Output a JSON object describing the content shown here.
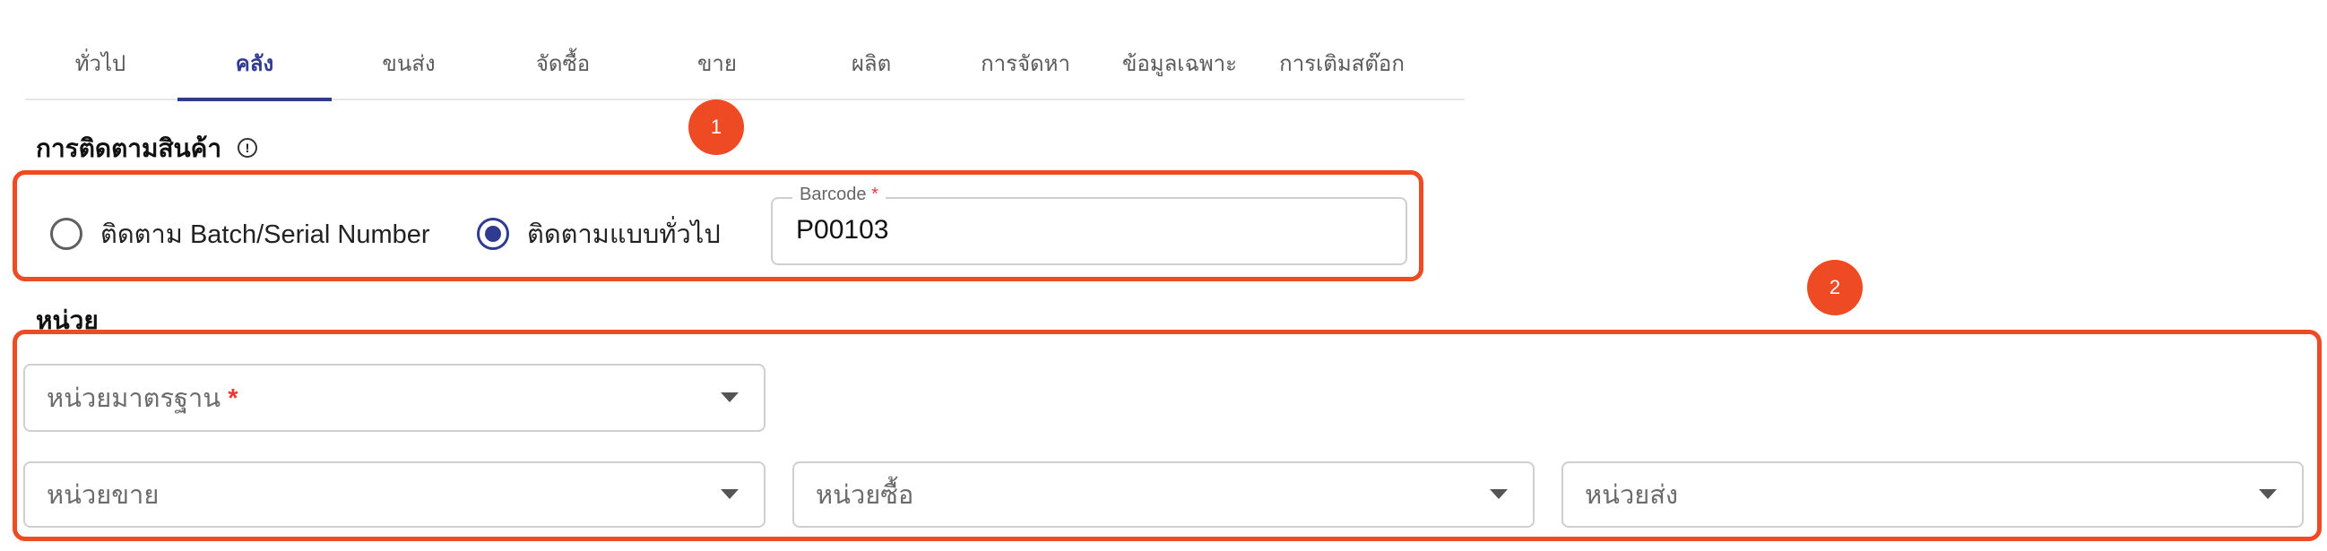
{
  "tabs": [
    {
      "label": "ทั่วไป"
    },
    {
      "label": "คลัง"
    },
    {
      "label": "ขนส่ง"
    },
    {
      "label": "จัดซื้อ"
    },
    {
      "label": "ขาย"
    },
    {
      "label": "ผลิต"
    },
    {
      "label": "การจัดหา"
    },
    {
      "label": "ข้อมูลเฉพาะ"
    },
    {
      "label": "การเติมสต๊อก"
    }
  ],
  "active_tab": "คลัง",
  "tracking": {
    "heading": "การติดตามสินค้า",
    "info_icon": "info-icon",
    "options": [
      {
        "label": "ติดตาม Batch/Serial Number",
        "selected": false
      },
      {
        "label": "ติดตามแบบทั่วไป",
        "selected": true
      }
    ],
    "barcode": {
      "label": "Barcode",
      "required_mark": "*",
      "value": "P00103"
    }
  },
  "units": {
    "heading": "หน่วย",
    "standard_unit": {
      "placeholder": "หน่วยมาตรฐาน",
      "required_mark": "*"
    },
    "sales_unit": {
      "placeholder": "หน่วยขาย"
    },
    "purchase_unit": {
      "placeholder": "หน่วยซื้อ"
    },
    "shipping_unit": {
      "placeholder": "หน่วยส่ง"
    }
  },
  "annotations": [
    {
      "number": "1"
    },
    {
      "number": "2"
    }
  ],
  "colors": {
    "accent": "#2f3b8f",
    "annotation": "#ee4a24",
    "required": "#e53935"
  }
}
